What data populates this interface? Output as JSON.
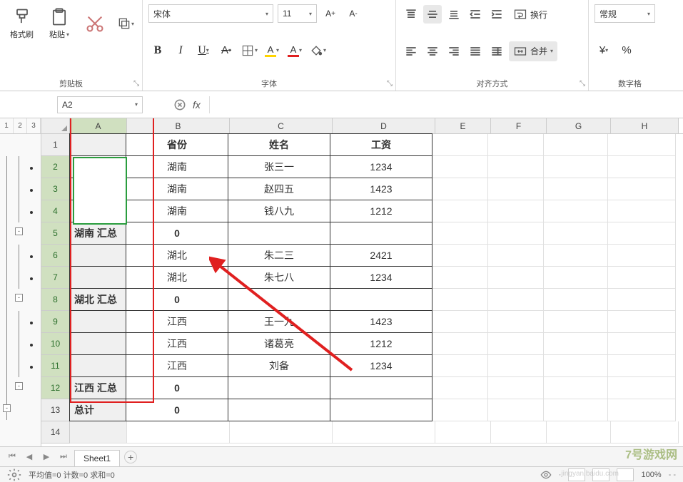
{
  "ribbon": {
    "clipboard": {
      "label": "剪贴板",
      "format_painter": "格式刷",
      "paste": "粘贴"
    },
    "font": {
      "label": "字体",
      "name": "宋体",
      "size": "11"
    },
    "alignment": {
      "label": "对齐方式",
      "wrap": "换行",
      "merge": "合并"
    },
    "number": {
      "label": "数字格",
      "format": "常规",
      "currency": "¥"
    }
  },
  "namebox": "A2",
  "fx": "fx",
  "outline": [
    "1",
    "2",
    "3"
  ],
  "columns": [
    "A",
    "B",
    "C",
    "D",
    "E",
    "F",
    "G",
    "H"
  ],
  "rows": [
    {
      "n": 1,
      "A": "",
      "B": "省份",
      "C": "姓名",
      "D": "工资",
      "bold": true
    },
    {
      "n": 2,
      "A": "",
      "B": "湖南",
      "C": "张三一",
      "D": "1234"
    },
    {
      "n": 3,
      "A": "",
      "B": "湖南",
      "C": "赵四五",
      "D": "1423"
    },
    {
      "n": 4,
      "A": "",
      "B": "湖南",
      "C": "钱八九",
      "D": "1212"
    },
    {
      "n": 5,
      "A": "湖南 汇总",
      "B": "0",
      "C": "",
      "D": "",
      "bold": true
    },
    {
      "n": 6,
      "A": "",
      "B": "湖北",
      "C": "朱二三",
      "D": "2421"
    },
    {
      "n": 7,
      "A": "",
      "B": "湖北",
      "C": "朱七八",
      "D": "1234"
    },
    {
      "n": 8,
      "A": "湖北 汇总",
      "B": "0",
      "C": "",
      "D": "",
      "bold": true
    },
    {
      "n": 9,
      "A": "",
      "B": "江西",
      "C": "王一九",
      "D": "1423"
    },
    {
      "n": 10,
      "A": "",
      "B": "江西",
      "C": "诸葛亮",
      "D": "1212"
    },
    {
      "n": 11,
      "A": "",
      "B": "江西",
      "C": "刘备",
      "D": "1234"
    },
    {
      "n": 12,
      "A": "江西 汇总",
      "B": "0",
      "C": "",
      "D": "",
      "bold": true
    },
    {
      "n": 13,
      "A": "总计",
      "B": "0",
      "C": "",
      "D": "",
      "bold": true
    },
    {
      "n": 14,
      "A": ""
    }
  ],
  "tabs": {
    "sheet1": "Sheet1"
  },
  "status": {
    "left": "平均值=0  计数=0  求和=0",
    "zoom": "100%"
  },
  "watermark": "7号游戏网",
  "watermark2": "jingyan.baidu.com"
}
